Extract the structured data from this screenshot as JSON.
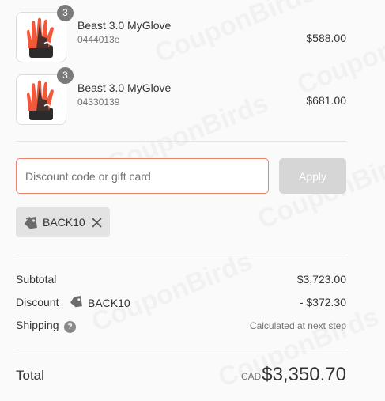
{
  "cart": {
    "items": [
      {
        "name": "Beast 3.0 MyGlove",
        "sku": "0444013e",
        "price": "$588.00",
        "quantity": "3"
      },
      {
        "name": "Beast 3.0 MyGlove",
        "sku": "04330139",
        "price": "$681.00",
        "quantity": "3"
      }
    ]
  },
  "discount_form": {
    "placeholder": "Discount code or gift card",
    "apply_label": "Apply"
  },
  "applied_code": {
    "label": "BACK10"
  },
  "summary": {
    "subtotal_label": "Subtotal",
    "subtotal_value": "$3,723.00",
    "discount_label": "Discount",
    "discount_code": "BACK10",
    "discount_value": "- $372.30",
    "shipping_label": "Shipping",
    "shipping_help": "?",
    "shipping_value": "Calculated at next step",
    "total_label": "Total",
    "currency": "CAD",
    "total_value": "$3,350.70"
  },
  "watermark": "CouponBirds",
  "colors": {
    "accent_border": "#e8846e",
    "apply_disabled": "#d6d6d6",
    "qty_badge": "#7a7a7a",
    "tag_bg": "#e3e3e3",
    "glove_orange": "#f2583a",
    "glove_dark": "#2b2b2b"
  }
}
